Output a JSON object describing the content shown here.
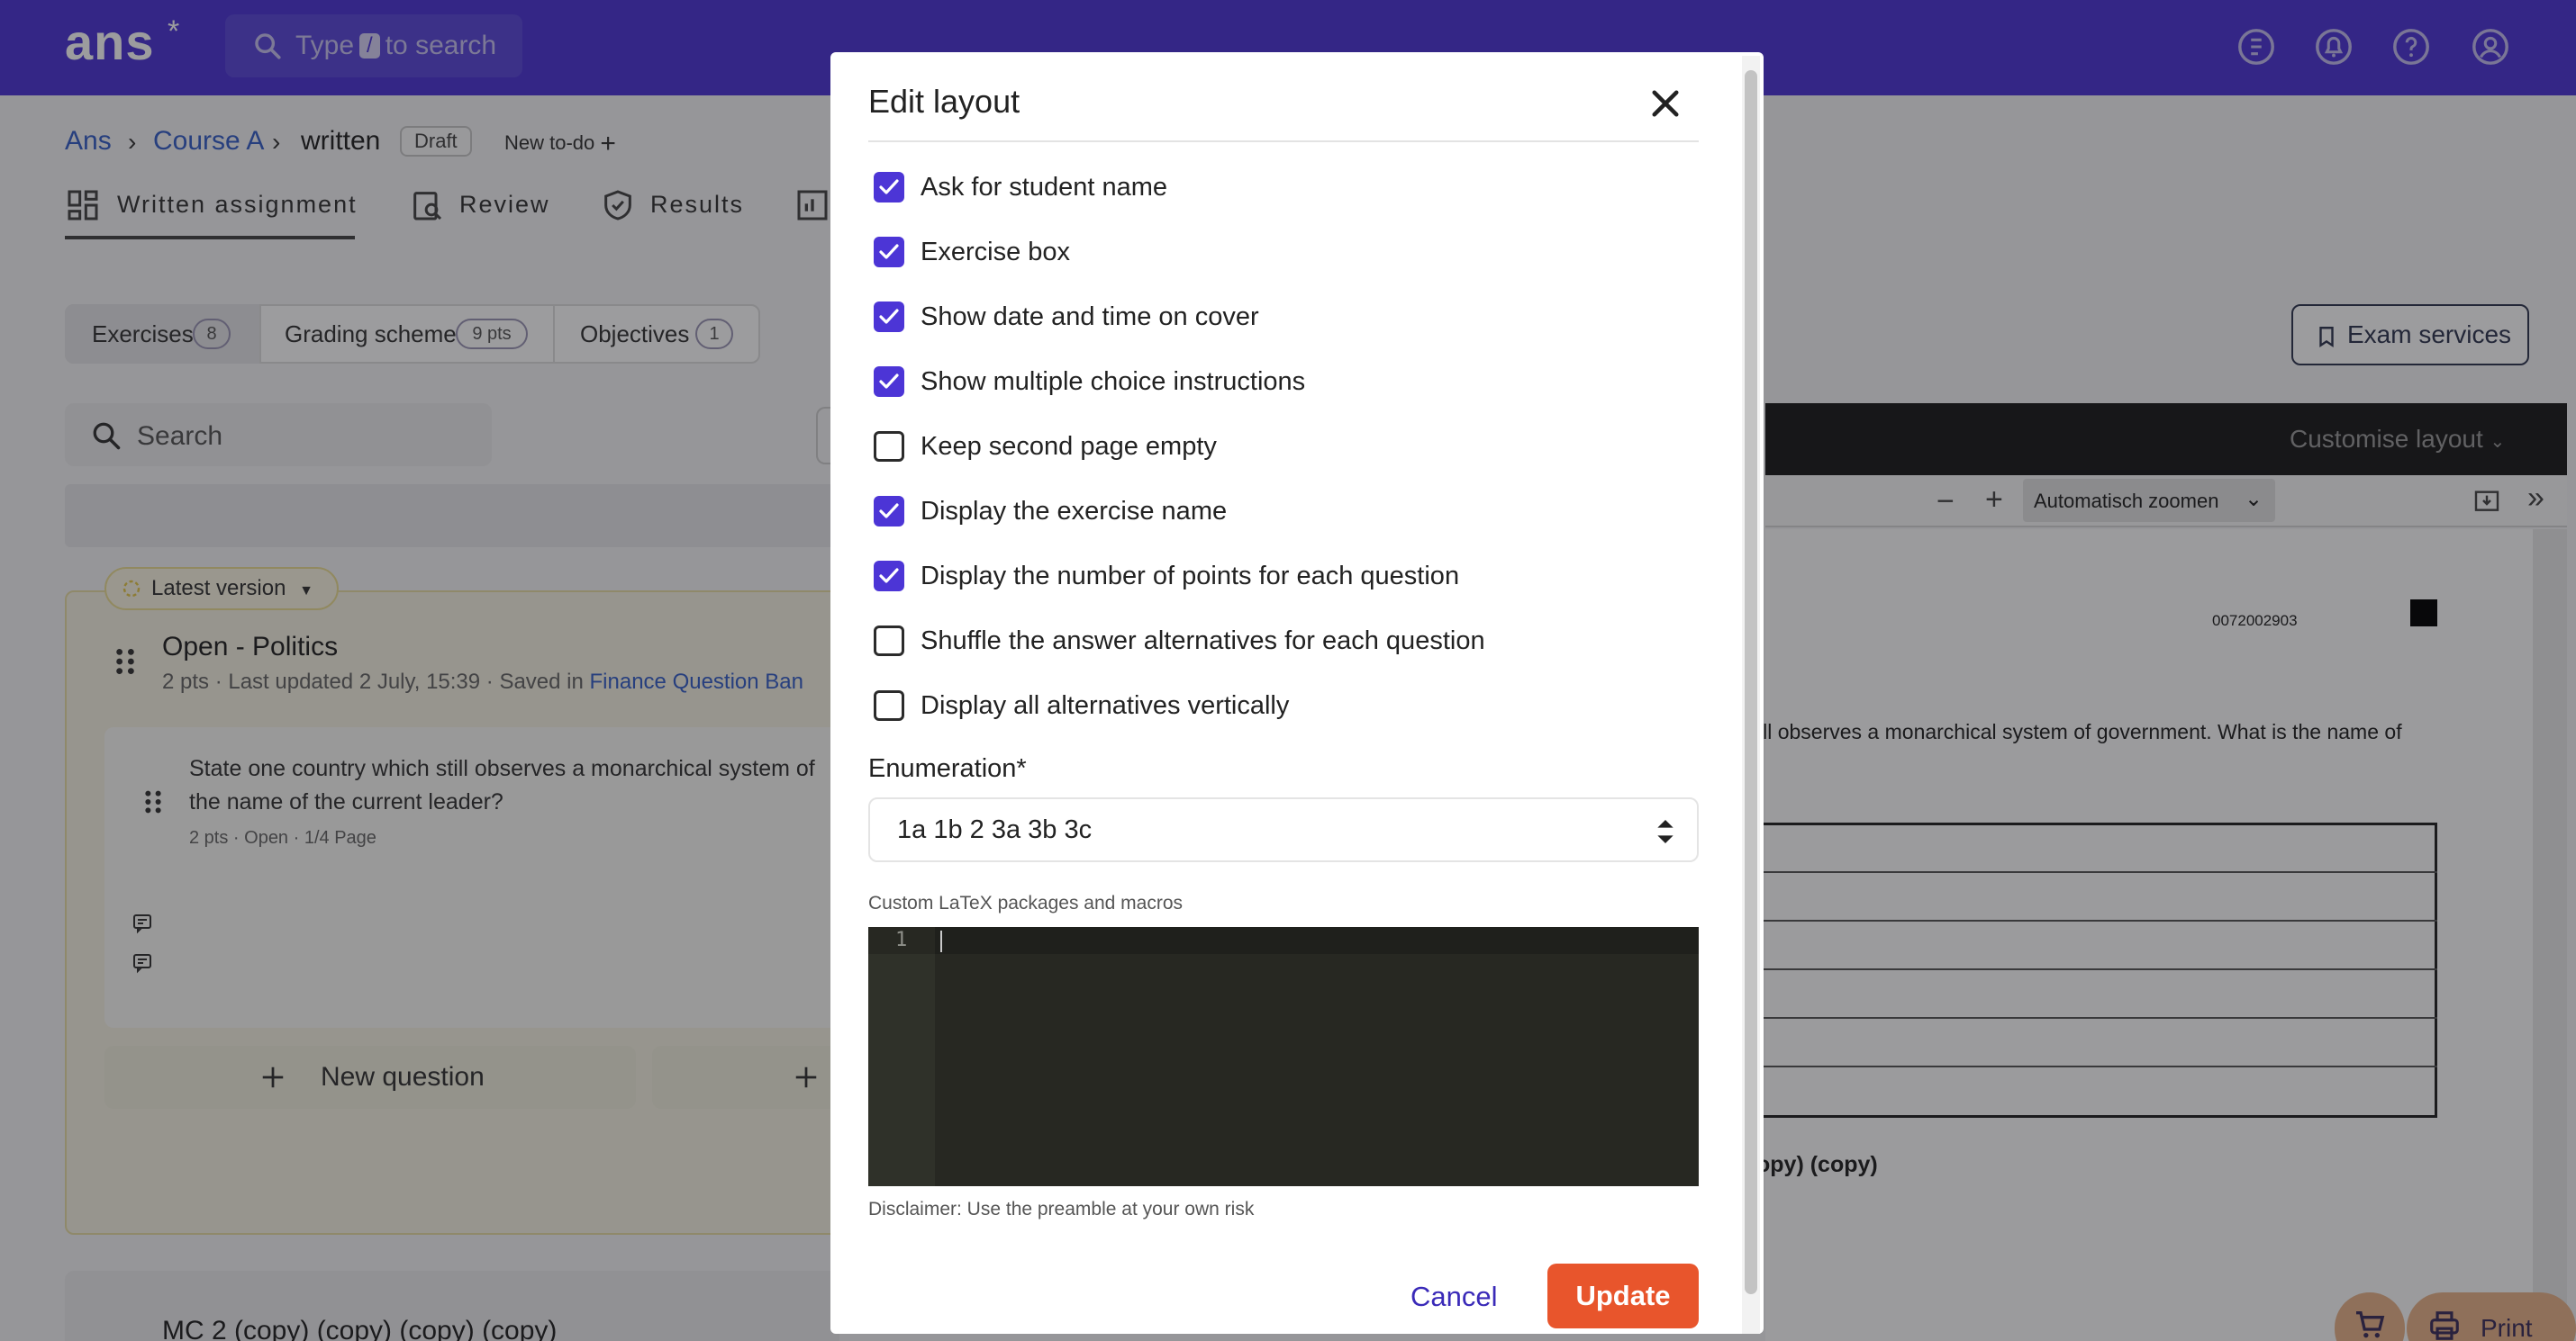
{
  "topbar": {
    "logo": "ans",
    "search_placeholder_before": "Type",
    "search_key": "/",
    "search_placeholder_after": "to search",
    "icons": [
      "coin-icon",
      "bell-icon",
      "help-icon",
      "user-icon"
    ]
  },
  "breadcrumb": {
    "items": [
      "Ans",
      "Course A",
      "written"
    ],
    "status": "Draft",
    "new_todo": "New to-do"
  },
  "tabs": [
    "Written assignment",
    "Review",
    "Results"
  ],
  "segments": [
    {
      "label": "Exercises",
      "count": "8"
    },
    {
      "label": "Grading scheme",
      "count": "9 pts"
    },
    {
      "label": "Objectives",
      "count": "1"
    }
  ],
  "left": {
    "search_placeholder": "Search",
    "version_label": "Latest version",
    "exercise_title": "Open - Politics",
    "exercise_meta": "2 pts · Last updated 2 July, 15:39 · Saved in ",
    "exercise_bank": "Finance Question Ban",
    "question_text_1": "State one country which still observes a monarchical system of",
    "question_text_2": "the name of the current leader?",
    "question_meta": "2 pts · Open · 1/4 Page",
    "new_question": "New question",
    "next_exercise_title": "MC 2 (copy) (copy) (copy) (copy)"
  },
  "right": {
    "exam_services": "Exam services",
    "customise_layout": "Customise layout",
    "zoom": "Automatisch zoomen",
    "pdf_id": "0072002903",
    "pdf_question": "ill observes a monarchical system of government. What is the name of",
    "pdf_copy": "opy) (copy)",
    "print": "Print"
  },
  "modal": {
    "title": "Edit layout",
    "options": [
      {
        "label": "Ask for student name",
        "checked": true
      },
      {
        "label": "Exercise box",
        "checked": true
      },
      {
        "label": "Show date and time on cover",
        "checked": true
      },
      {
        "label": "Show multiple choice instructions",
        "checked": true
      },
      {
        "label": "Keep second page empty",
        "checked": false
      },
      {
        "label": "Display the exercise name",
        "checked": true
      },
      {
        "label": "Display the number of points for each question",
        "checked": true
      },
      {
        "label": "Shuffle the answer alternatives for each question",
        "checked": false
      },
      {
        "label": "Display all alternatives vertically",
        "checked": false
      }
    ],
    "enumeration_label": "Enumeration*",
    "enumeration_value": "1a 1b 2 3a 3b 3c",
    "latex_label": "Custom LaTeX packages and macros",
    "editor_line": "1",
    "disclaimer": "Disclaimer: Use the preamble at your own risk",
    "cancel": "Cancel",
    "update": "Update"
  },
  "colors": {
    "brand": "#4c35d6",
    "update": "#e8552c"
  }
}
